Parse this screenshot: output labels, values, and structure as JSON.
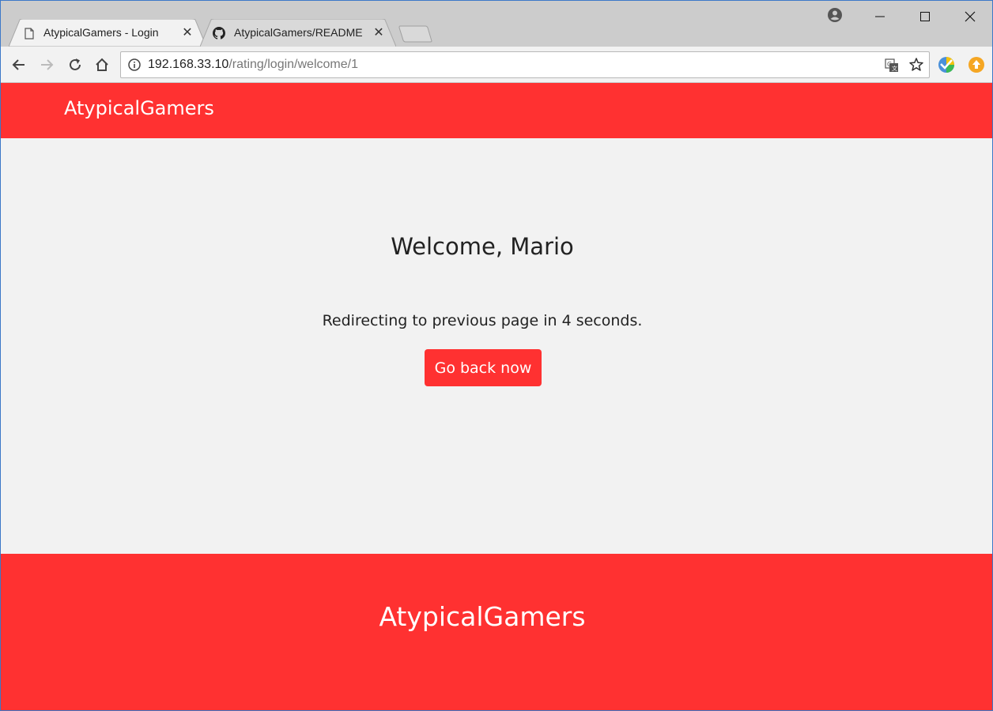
{
  "browser": {
    "tabs": [
      {
        "title": "AtypicalGamers - Login",
        "favicon": "page-icon",
        "active": true
      },
      {
        "title": "AtypicalGamers/README",
        "favicon": "github-icon",
        "active": false
      }
    ],
    "address": {
      "host": "192.168.33.10",
      "path": "/rating/login/welcome/1"
    },
    "icons": {
      "back": "arrow-left-icon",
      "forward": "arrow-right-icon",
      "reload": "reload-icon",
      "home": "home-icon",
      "info": "info-icon",
      "translate": "translate-icon",
      "bookmark": "star-icon",
      "profile": "profile-icon",
      "extension1": "extension-icon",
      "extension2": "extension-upload-icon"
    }
  },
  "site": {
    "brand": "AtypicalGamers",
    "welcome": "Welcome, Mario",
    "redirect_text": "Redirecting to previous page in 4 seconds.",
    "back_button": "Go back now",
    "footer_brand": "AtypicalGamers"
  },
  "colors": {
    "accent": "#ff3131",
    "page_background": "#f2f2f2",
    "tabstrip": "#cccccc"
  }
}
